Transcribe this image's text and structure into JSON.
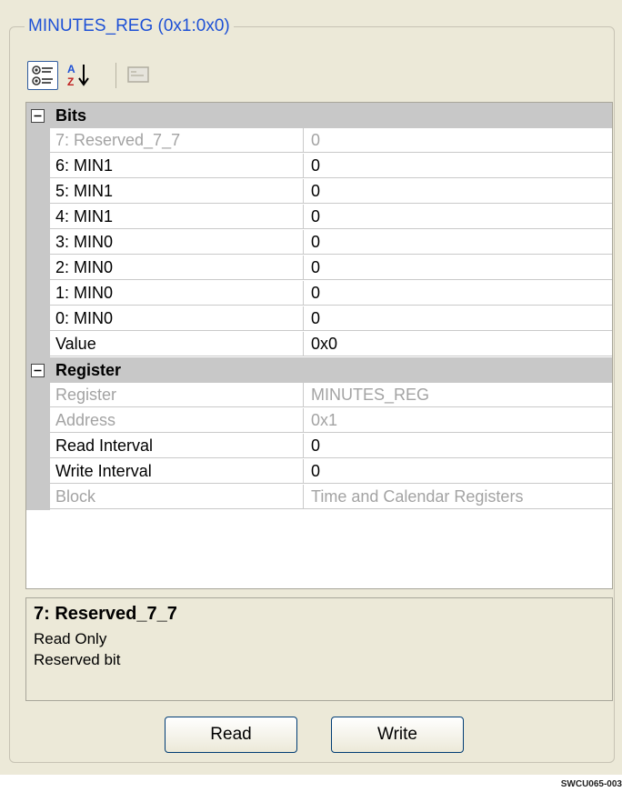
{
  "group_title": "MINUTES_REG (0x1:0x0)",
  "toolbar": {
    "categorized_icon": "categorized-view-icon",
    "sort_icon": "alphabetical-sort-icon",
    "pages_icon": "property-pages-icon"
  },
  "categories": [
    {
      "label": "Bits",
      "expanded": true,
      "rows": [
        {
          "name": "7: Reserved_7_7",
          "value": "0",
          "readonly": true
        },
        {
          "name": "6: MIN1",
          "value": "0",
          "readonly": false
        },
        {
          "name": "5: MIN1",
          "value": "0",
          "readonly": false
        },
        {
          "name": "4: MIN1",
          "value": "0",
          "readonly": false
        },
        {
          "name": "3: MIN0",
          "value": "0",
          "readonly": false
        },
        {
          "name": "2: MIN0",
          "value": "0",
          "readonly": false
        },
        {
          "name": "1: MIN0",
          "value": "0",
          "readonly": false
        },
        {
          "name": "0: MIN0",
          "value": "0",
          "readonly": false
        },
        {
          "name": "Value",
          "value": "0x0",
          "readonly": false
        }
      ]
    },
    {
      "label": "Register",
      "expanded": true,
      "rows": [
        {
          "name": "Register",
          "value": "MINUTES_REG",
          "readonly": true
        },
        {
          "name": "Address",
          "value": "0x1",
          "readonly": true
        },
        {
          "name": "Read Interval",
          "value": "0",
          "readonly": false
        },
        {
          "name": "Write Interval",
          "value": "0",
          "readonly": false
        },
        {
          "name": "Block",
          "value": "Time and Calendar Registers",
          "readonly": true
        }
      ]
    }
  ],
  "description": {
    "title": "7: Reserved_7_7",
    "line1": "Read Only",
    "line2": "Reserved bit"
  },
  "buttons": {
    "read": "Read",
    "write": "Write"
  },
  "footer_code": "SWCU065-003",
  "colors": {
    "title_blue": "#1d50d6",
    "disabled_text": "#a3a3a3",
    "category_bg": "#c8c8c8",
    "panel_bg": "#ece9d8"
  }
}
